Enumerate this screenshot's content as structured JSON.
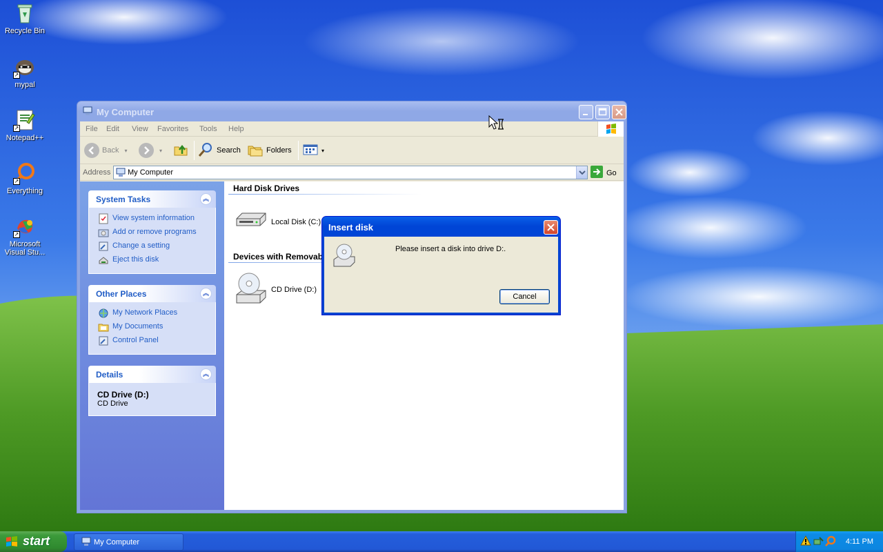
{
  "desktop": {
    "icons": [
      {
        "label": "Recycle Bin",
        "icon": "recycle-bin-icon"
      },
      {
        "label": "mypal",
        "icon": "mypal-browser-icon"
      },
      {
        "label": "Notepad++",
        "icon": "notepadpp-icon"
      },
      {
        "label": "Everything",
        "icon": "everything-search-icon"
      },
      {
        "label": "Microsoft Visual Stu...",
        "icon": "visual-studio-icon"
      }
    ]
  },
  "explorer": {
    "title": "My Computer",
    "menu": [
      "File",
      "Edit",
      "View",
      "Favorites",
      "Tools",
      "Help"
    ],
    "toolbar": {
      "back": "Back",
      "search": "Search",
      "folders": "Folders"
    },
    "address": {
      "label": "Address",
      "value": "My Computer",
      "go": "Go"
    },
    "system_tasks": {
      "title": "System Tasks",
      "items": [
        "View system information",
        "Add or remove programs",
        "Change a setting",
        "Eject this disk"
      ]
    },
    "other_places": {
      "title": "Other Places",
      "items": [
        "My Network Places",
        "My Documents",
        "Control Panel"
      ]
    },
    "details": {
      "title": "Details",
      "name": "CD Drive (D:)",
      "type": "CD Drive"
    },
    "groups": [
      {
        "heading": "Hard Disk Drives",
        "items": [
          "Local Disk (C:)"
        ]
      },
      {
        "heading": "Devices with Removab",
        "items": [
          "CD Drive (D:)"
        ]
      }
    ]
  },
  "dialog": {
    "title": "Insert disk",
    "message": "Please insert a disk into drive D:.",
    "cancel": "Cancel"
  },
  "taskbar": {
    "start": "start",
    "task": "My Computer",
    "clock": "4:11 PM"
  }
}
